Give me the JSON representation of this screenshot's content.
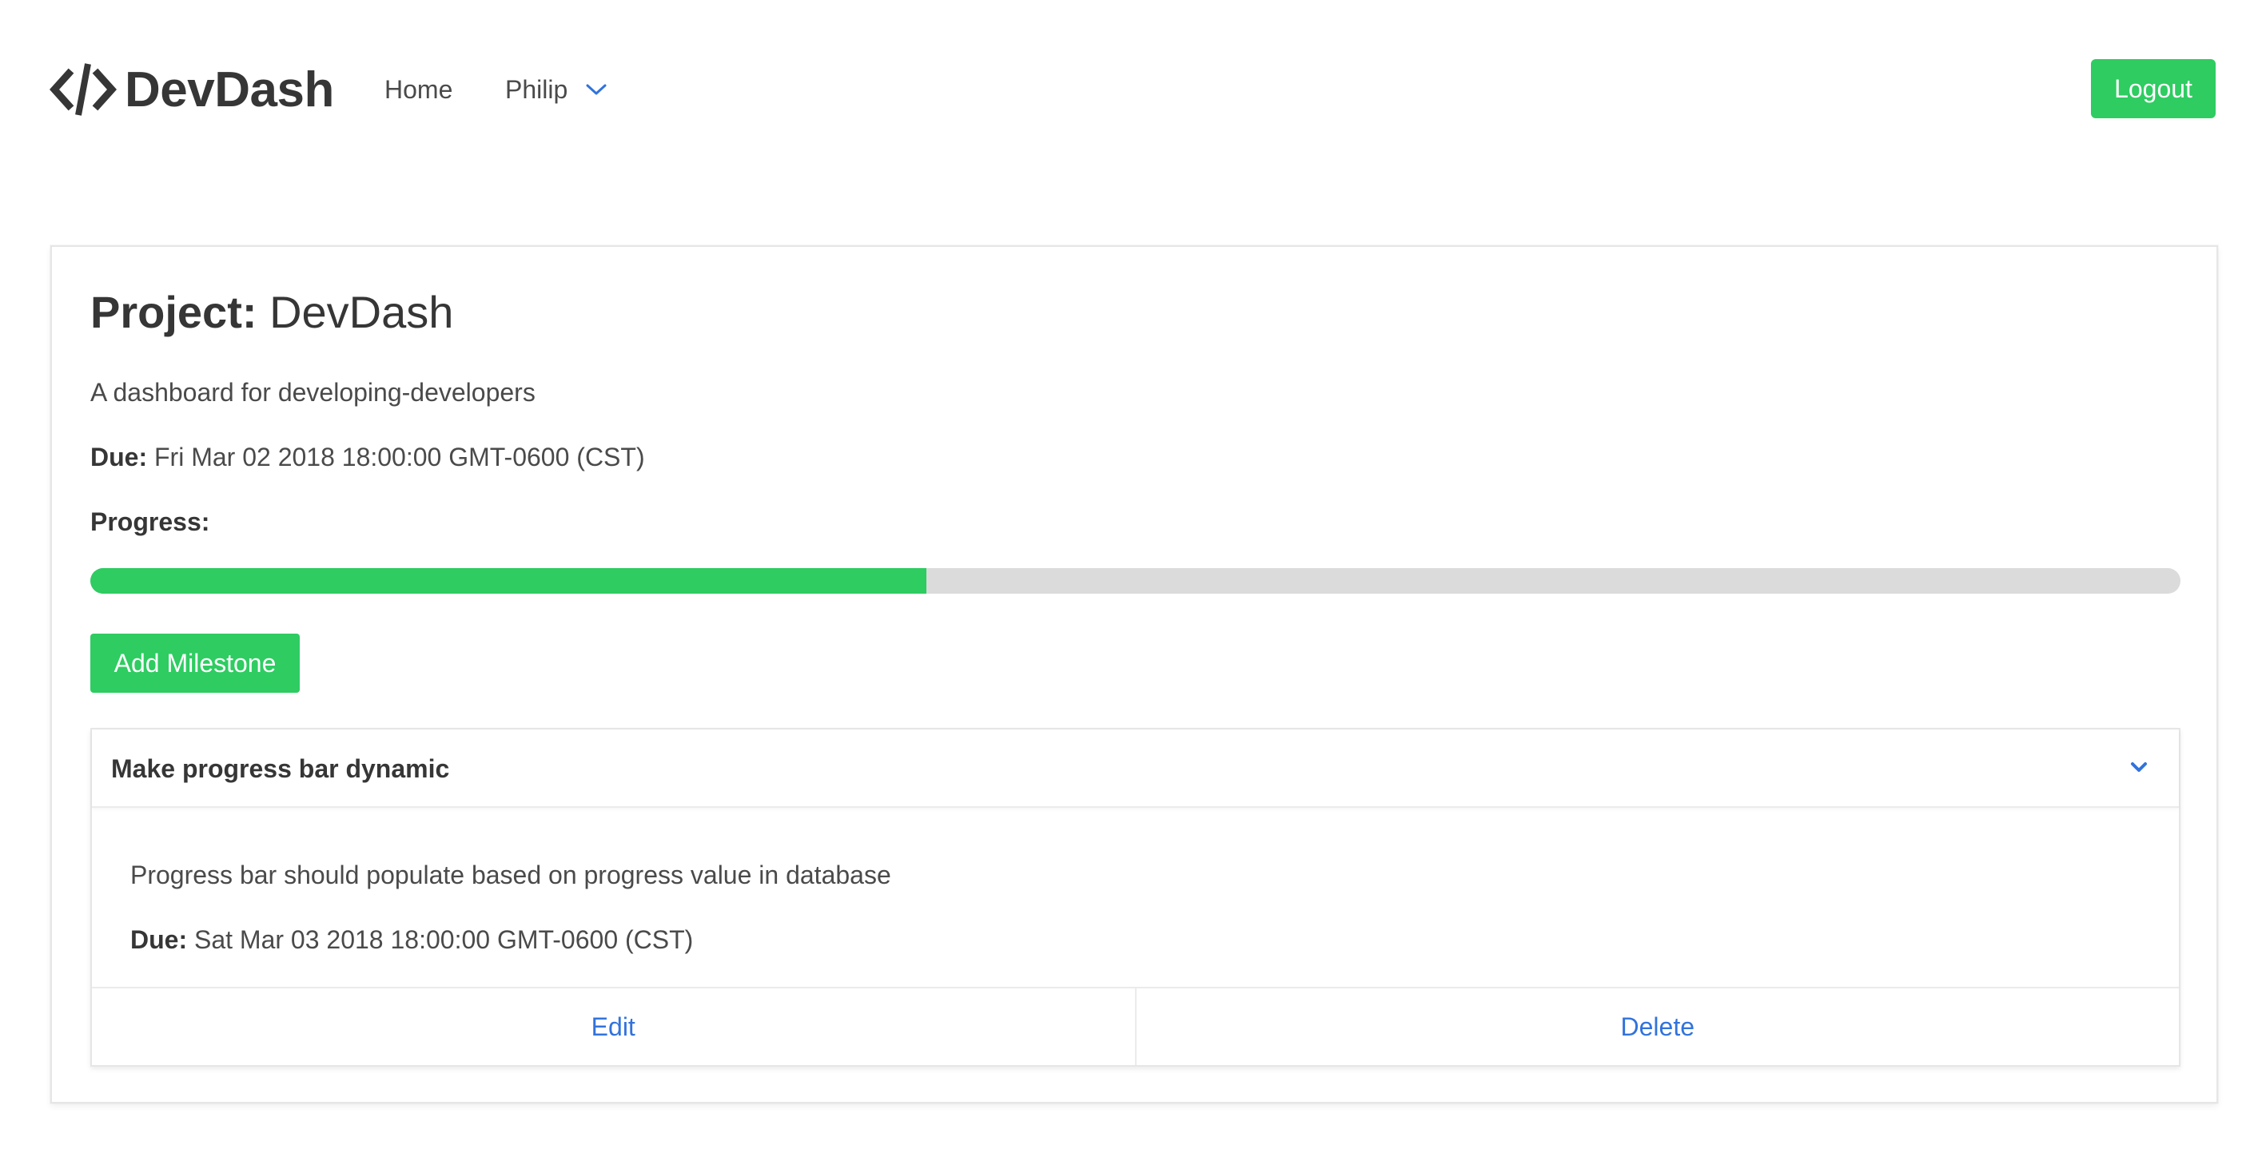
{
  "navbar": {
    "brand_name": "DevDash",
    "brand_icon": "code-icon",
    "home_label": "Home",
    "user_label": "Philip",
    "user_dropdown_icon": "chevron-down-icon",
    "logout_label": "Logout"
  },
  "project": {
    "title_label": "Project:",
    "title_value": "DevDash",
    "description": "A dashboard for developing-developers",
    "due_label": "Due:",
    "due_value": "Fri Mar 02 2018 18:00:00 GMT-0600 (CST)",
    "progress_label": "Progress:",
    "progress_fraction": 0.4,
    "add_milestone_label": "Add Milestone"
  },
  "milestone": {
    "title": "Make progress bar dynamic",
    "toggle_icon": "chevron-down-icon",
    "description": "Progress bar should populate based on progress value in database",
    "due_label": "Due:",
    "due_value": "Sat Mar 03 2018 18:00:00 GMT-0600 (CST)",
    "edit_label": "Edit",
    "delete_label": "Delete"
  },
  "colors": {
    "accent_green": "#2ecc61",
    "link_blue": "#3273dc",
    "track_grey": "#dbdbdb",
    "text_dark": "#363636"
  }
}
